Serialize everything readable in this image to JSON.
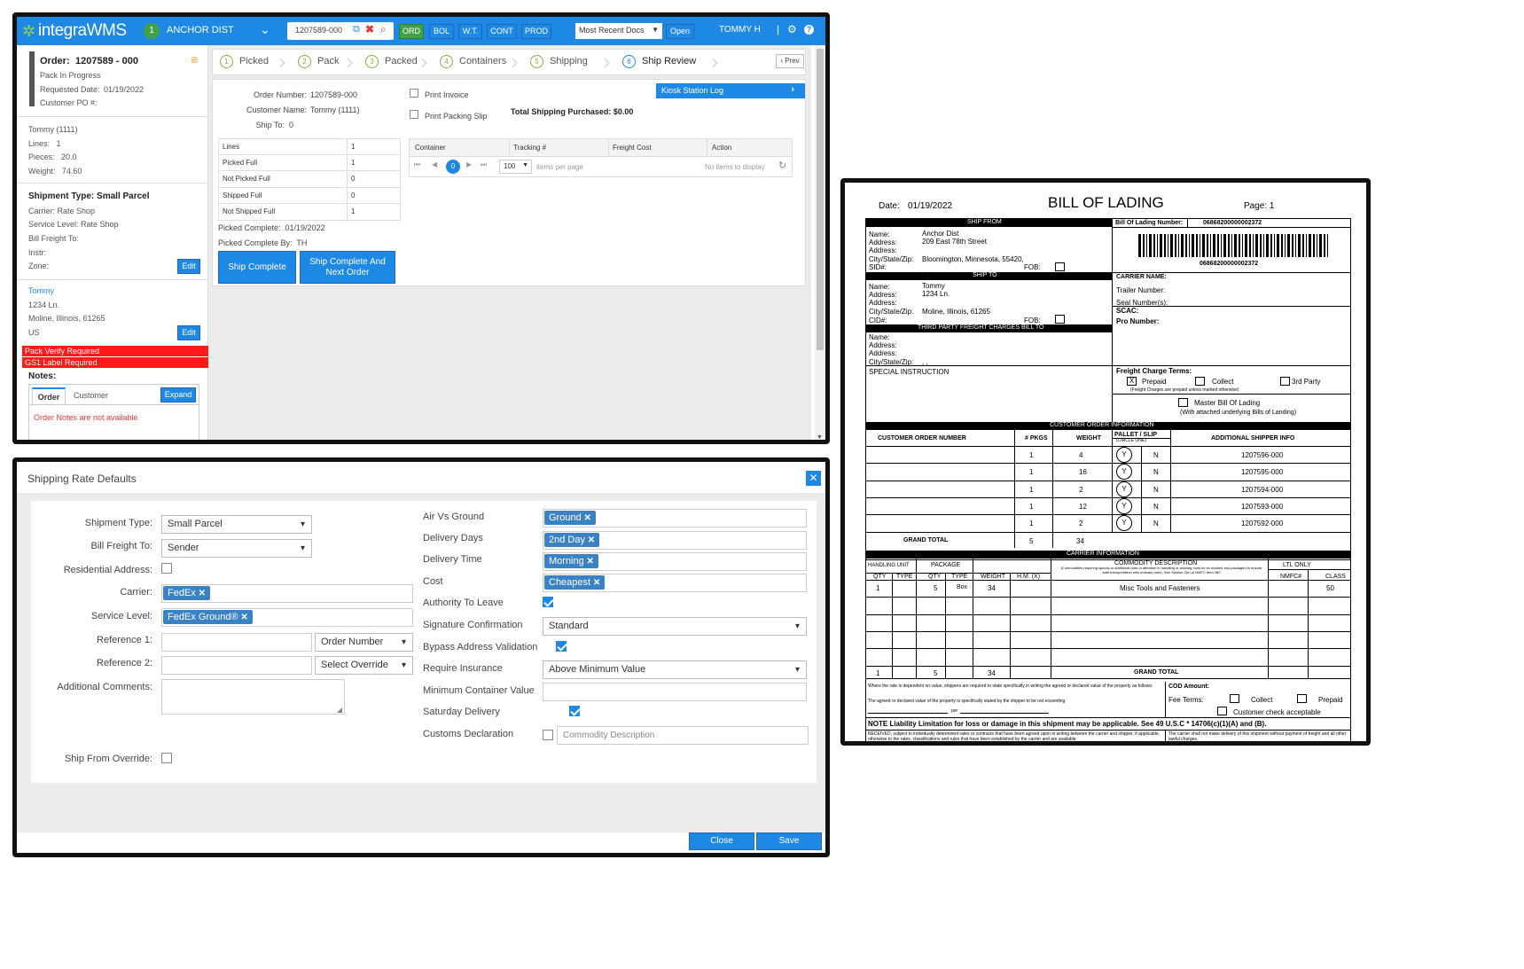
{
  "app": {
    "logo": "integraWMS",
    "company_badge": "1",
    "company": "ANCHOR DIST",
    "search_value": "1207589-000",
    "nav": [
      "ORD",
      "BOL",
      "W.T.",
      "CONT",
      "PROD"
    ],
    "docs_select": "Most Recent Docs",
    "open_label": "Open",
    "user": "TOMMY H",
    "sep": "|"
  },
  "order": {
    "title": "Order:",
    "number": "1207589 - 000",
    "status": "Pack In Progress",
    "req_label": "Requested Date:",
    "req_date": "01/19/2022",
    "po_label": "Customer PO #:",
    "customer": "Tommy (1111)",
    "lines": "Lines:   1",
    "pieces": "Pieces:   20.0",
    "weight": "Weight:   74.60"
  },
  "shipment": {
    "title": "Shipment Type: Small Parcel",
    "carrier": "Carrier: Rate Shop",
    "service": "Service Level: Rate Shop",
    "bill": "Bill Freight To:",
    "instr": "Instr:",
    "zone": "Zone:",
    "edit": "Edit"
  },
  "address": {
    "name": "Tommy",
    "line1": "1234 Ln.",
    "line2": "Moline, Illinois, 61265",
    "country": "US",
    "edit": "Edit"
  },
  "alerts": [
    "Pack Verify Required",
    "GS1 Label Required"
  ],
  "notes": {
    "label": "Notes:",
    "tab_order": "Order",
    "tab_customer": "Customer",
    "expand": "Expand",
    "empty": "Order Notes are not available"
  },
  "steps": [
    {
      "n": "1",
      "label": "Picked"
    },
    {
      "n": "2",
      "label": "Pack"
    },
    {
      "n": "3",
      "label": "Packed"
    },
    {
      "n": "4",
      "label": "Containers"
    },
    {
      "n": "5",
      "label": "Shipping"
    },
    {
      "n": "6",
      "label": "Ship Review"
    }
  ],
  "prev": "‹ Prev",
  "review": {
    "order_label": "Order Number:",
    "order_val": "1207589-000",
    "cust_label": "Customer Name:",
    "cust_val": "Tommy (1111)",
    "shipto_label": "Ship To:",
    "shipto_val": "0",
    "print_invoice": "Print Invoice",
    "print_packing": "Print Packing Slip",
    "total_shipping": "Total Shipping Purchased: $0.00",
    "kiosk": "Kiosk Station Log",
    "stats": [
      [
        "Lines",
        "1"
      ],
      [
        "Picked Full",
        "1"
      ],
      [
        "Not Picked Full",
        "0"
      ],
      [
        "Shipped Full",
        "0"
      ],
      [
        "Not Shipped Full",
        "1"
      ]
    ],
    "picked_complete": "Picked Complete:  01/19/2022",
    "picked_by": "Picked Complete By:  TH",
    "ship_complete": "Ship Complete",
    "ship_next": "Ship Complete And Next Order",
    "grid_cols": [
      "Container",
      "Tracking #",
      "Freight Cost",
      "Action"
    ],
    "page_num": "0",
    "page_size": "100",
    "items_per_page": "items per page",
    "no_items": "No items to display"
  },
  "rates": {
    "title": "Shipping Rate Defaults",
    "shipment_type_label": "Shipment Type:",
    "shipment_type": "Small Parcel",
    "bill_label": "Bill Freight To:",
    "bill": "Sender",
    "residential_label": "Residential Address:",
    "carrier_label": "Carrier:",
    "carrier_tag": "FedEx",
    "service_label": "Service Level:",
    "service_tag": "FedEx Ground®",
    "ref1_label": "Reference 1:",
    "ref1_sel": "Order Number",
    "ref2_label": "Reference 2:",
    "ref2_sel": "Select Override",
    "comments_label": "Additional Comments:",
    "shipfrom_label": "Ship From Override:",
    "air_label": "Air Vs Ground",
    "air_tag": "Ground",
    "days_label": "Delivery Days",
    "days_tag": "2nd Day",
    "time_label": "Delivery Time",
    "time_tag": "Morning",
    "cost_label": "Cost",
    "cost_tag": "Cheapest",
    "auth_label": "Authority To Leave",
    "sig_label": "Signature Confirmation",
    "sig_val": "Standard",
    "bypass_label": "Bypass Address Validation",
    "ins_label": "Require Insurance",
    "ins_val": "Above Minimum Value",
    "min_label": "Minimum Container Value",
    "sat_label": "Saturday Delivery",
    "customs_label": "Customs Declaration",
    "commodity_ph": "Commodity Description",
    "close": "Close",
    "save": "Save"
  },
  "bol": {
    "date_label": "Date:",
    "date": "01/19/2022",
    "title": "BILL OF LADING",
    "page": "Page: 1",
    "ship_from": "SHIP FROM",
    "bol_no_label": "Bill Of Lading Number:",
    "bol_no": "06868200000002372",
    "name_l": "Name:",
    "addr_l": "Address:",
    "addr2_l": "Address:",
    "csz_l": "City/State/Zip:",
    "sid_l": "SID#:",
    "fob": "FOB:",
    "from_name": "Anchor Dist",
    "from_addr": "209 East 78th Street",
    "from_csz": "Bloomington, Minnesota, 55420,",
    "ship_to": "SHIP TO",
    "cid_l": "CID#:",
    "to_name": "Tommy",
    "to_addr": "1234 Ln.",
    "to_csz": "Moline, Illinois, 61265",
    "carrier_name": "CARRIER NAME:",
    "trailer": "Trailer Number:",
    "seal": "Seal Number(s):",
    "scac": "SCAC:",
    "pro": "Pro Number:",
    "third_party": "THIRD PARTY FREIGHT CHARGES BILL TO",
    "tp_csz": ", ,",
    "special": "SPECIAL INSTRUCTION",
    "fct": "Freight Charge Terms:",
    "prepaid": "Prepaid",
    "collect": "Collect",
    "third": "3rd Party",
    "prepaid_note": "(Freight Charges are prepaid unless marked otherwise)",
    "x": "X",
    "master": "Master Bill Of Lading",
    "master_note": "(With attached underlying Bills of Landing)",
    "coi": "CUSTOMER ORDER INFORMATION",
    "coi_cols": [
      "CUSTOMER ORDER NUMBER",
      "# PKGS",
      "WEIGHT",
      "PALLET / SLIP",
      "ADDITIONAL SHIPPER INFO"
    ],
    "circle_one": "(CIRCLE ONE)",
    "y": "Y",
    "n": "N",
    "orders": [
      [
        "1",
        "4",
        "1207596-000"
      ],
      [
        "1",
        "16",
        "1207595-000"
      ],
      [
        "1",
        "2",
        "1207594-000"
      ],
      [
        "1",
        "12",
        "1207593-000"
      ],
      [
        "1",
        "2",
        "1207592-000"
      ]
    ],
    "grand_total": "GRAND TOTAL",
    "gt_pkgs": "5",
    "gt_weight": "34",
    "carrier_info": "CARRIER INFORMATION",
    "handling": "HANDLING UNIT",
    "package": "PACKAGE",
    "commodity": "COMMODITY DESCRIPTION",
    "commodity_note": "(Commodities requiring special or additional care or attention in handling or stowing must be so marked and packaged to ensure safe transportation with ordinary care). See Section 2(e) of NMFC Item 360",
    "ltl": "LTL ONLY",
    "ci_cols": [
      "QTY",
      "TYPE",
      "QTY",
      "TYPE",
      "WEIGHT",
      "H.M. (X)",
      "NMFC#",
      "CLASS"
    ],
    "ci_row": {
      "hqty": "1",
      "pqty": "5",
      "ptype": "Box",
      "weight": "34",
      "desc": "Misc Tools and Fasteners",
      "class": "50"
    },
    "ci_total": {
      "hqty": "1",
      "pqty": "5",
      "weight": "34",
      "label": "GRAND TOTAL"
    },
    "value_note": "Where the rate is dependent on value, shippers are required to state specifically in writing the agreed or declared value of the property as follows:",
    "value_note2": "The agreed or declared value of the property is specifically stated by the shipper to be not exceeding",
    "per": "per",
    "cod": "COD Amount:",
    "fee_terms": "Fee Terms:",
    "fee_collect": "Collect",
    "fee_prepaid": "Prepaid",
    "cust_check": "Customer check acceptable",
    "liability": "NOTE Liability Limitation for loss or damage in this shipment may be applicable.  See 49 U.S.C * 14706(c)(1)(A) and (B).",
    "received": "RECEIVED, subject to individually determined rates or contracts that have been agreed upon in writing between the carrier and shipper, if applicable, otherwise to the rates, classifications and rules that have been established by the carrier and are available",
    "carrier_note": "The carrier shall not make delivery of this shipment without payment of freight and all other lawful charges."
  },
  "colors": {
    "accent": "#1e88e5",
    "green": "#43a047",
    "red": "#ff1a1a",
    "teal": "#1aa1a1"
  }
}
